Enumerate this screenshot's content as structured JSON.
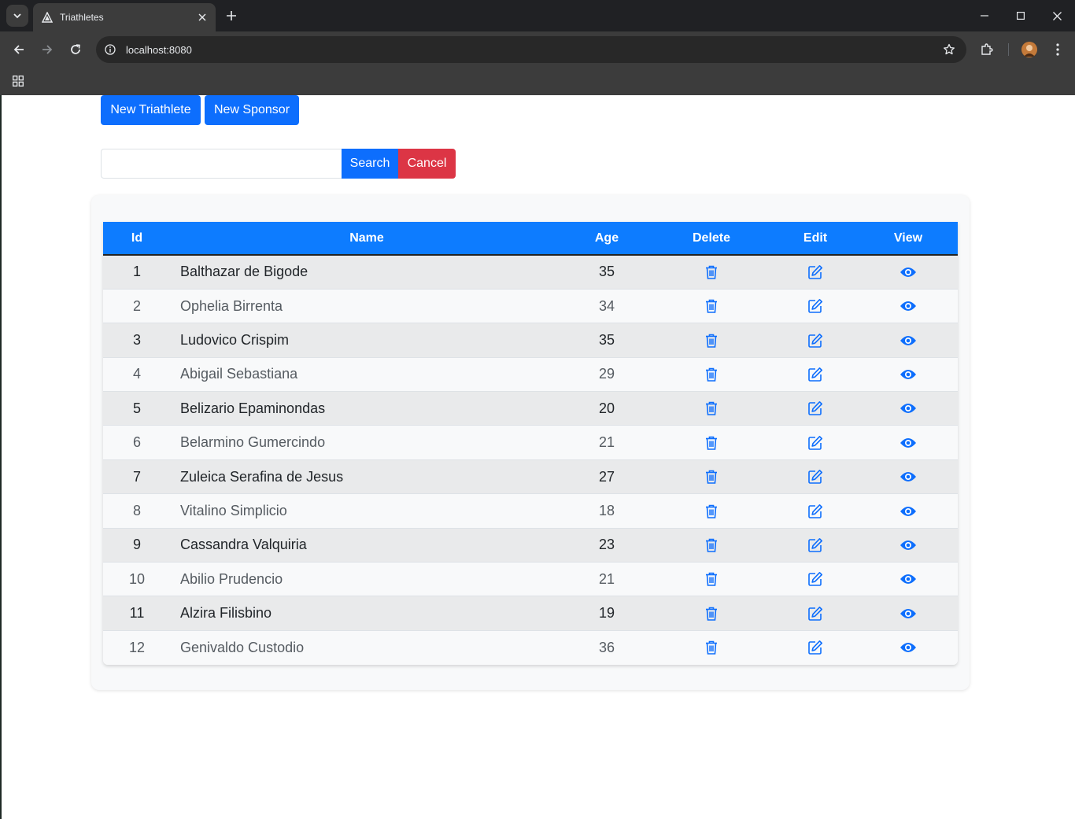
{
  "browser": {
    "tab_title": "Triathletes",
    "url": "localhost:8080"
  },
  "actions": {
    "new_triathlete": "New Triathlete",
    "new_sponsor": "New Sponsor"
  },
  "search": {
    "value": "",
    "placeholder": "",
    "search_label": "Search",
    "cancel_label": "Cancel"
  },
  "colors": {
    "primary": "#0d6efd",
    "danger": "#dc3545",
    "header": "#0d7cff"
  },
  "table": {
    "headers": [
      "Id",
      "Name",
      "Age",
      "Delete",
      "Edit",
      "View"
    ],
    "row_icons": [
      "trash-icon",
      "edit-icon",
      "eye-icon"
    ],
    "rows": [
      {
        "id": "1",
        "name": "Balthazar de Bigode",
        "age": "35"
      },
      {
        "id": "2",
        "name": "Ophelia Birrenta",
        "age": "34"
      },
      {
        "id": "3",
        "name": "Ludovico Crispim",
        "age": "35"
      },
      {
        "id": "4",
        "name": "Abigail Sebastiana",
        "age": "29"
      },
      {
        "id": "5",
        "name": "Belizario Epaminondas",
        "age": "20"
      },
      {
        "id": "6",
        "name": "Belarmino Gumercindo",
        "age": "21"
      },
      {
        "id": "7",
        "name": "Zuleica Serafina de Jesus",
        "age": "27"
      },
      {
        "id": "8",
        "name": "Vitalino Simplicio",
        "age": "18"
      },
      {
        "id": "9",
        "name": "Cassandra Valquiria",
        "age": "23"
      },
      {
        "id": "10",
        "name": "Abilio Prudencio",
        "age": "21"
      },
      {
        "id": "11",
        "name": "Alzira Filisbino",
        "age": "19"
      },
      {
        "id": "12",
        "name": "Genivaldo Custodio",
        "age": "36"
      }
    ]
  }
}
